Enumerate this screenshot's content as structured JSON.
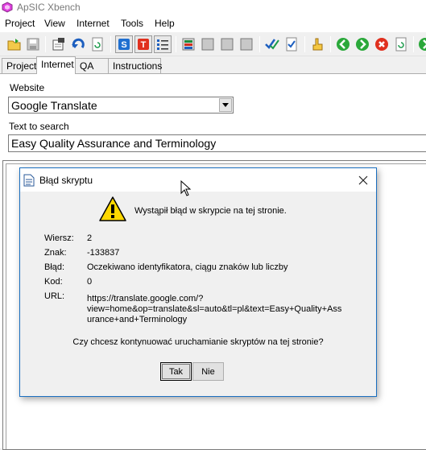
{
  "window": {
    "title": "ApSIC Xbench"
  },
  "menu": {
    "items": [
      "Project",
      "View",
      "Internet",
      "Tools",
      "Help"
    ]
  },
  "toolbar": {
    "buttons": [
      "open-folder-icon",
      "save-icon",
      "project-properties-icon",
      "undo-icon",
      "refresh-doc-icon",
      "source-icon",
      "target-icon",
      "list-view-icon",
      "color-grid-icon",
      "gray-square-icon",
      "gray-square-icon",
      "gray-square-icon",
      "check-all-icon",
      "checklist-icon",
      "hand-pointer-icon",
      "back-arrow-icon",
      "forward-arrow-icon",
      "stop-icon",
      "reload-icon",
      "next-icon"
    ]
  },
  "tabs": [
    "Project",
    "Internet",
    "QA",
    "Instructions"
  ],
  "active_tab": "Internet",
  "internet": {
    "website_label": "Website",
    "website_value": "Google Translate",
    "search_label": "Text to search",
    "search_value": "Easy Quality Assurance and Terminology"
  },
  "dialog": {
    "title": "Błąd skryptu",
    "message": "Wystąpił błąd w skrypcie na tej stronie.",
    "fields": [
      {
        "label": "Wiersz:",
        "value": "2"
      },
      {
        "label": "Znak:",
        "value": "-133837"
      },
      {
        "label": "Błąd:",
        "value": "Oczekiwano identyfikatora, ciągu znaków lub liczby"
      },
      {
        "label": "Kod:",
        "value": "0"
      },
      {
        "label": "URL:",
        "value_lines": [
          "https://translate.google.com/?",
          "view=home&op=translate&sl=auto&tl=pl&text=Easy+Quality+Ass",
          "urance+and+Terminology"
        ]
      }
    ],
    "question": "Czy chcesz kontynuować uruchamianie skryptów na tej stronie?",
    "yes_label": "Tak",
    "no_label": "Nie"
  },
  "colors": {
    "accent": "#1a6fc0",
    "warning": "#ffd800",
    "panel": "#f0f0f0"
  }
}
